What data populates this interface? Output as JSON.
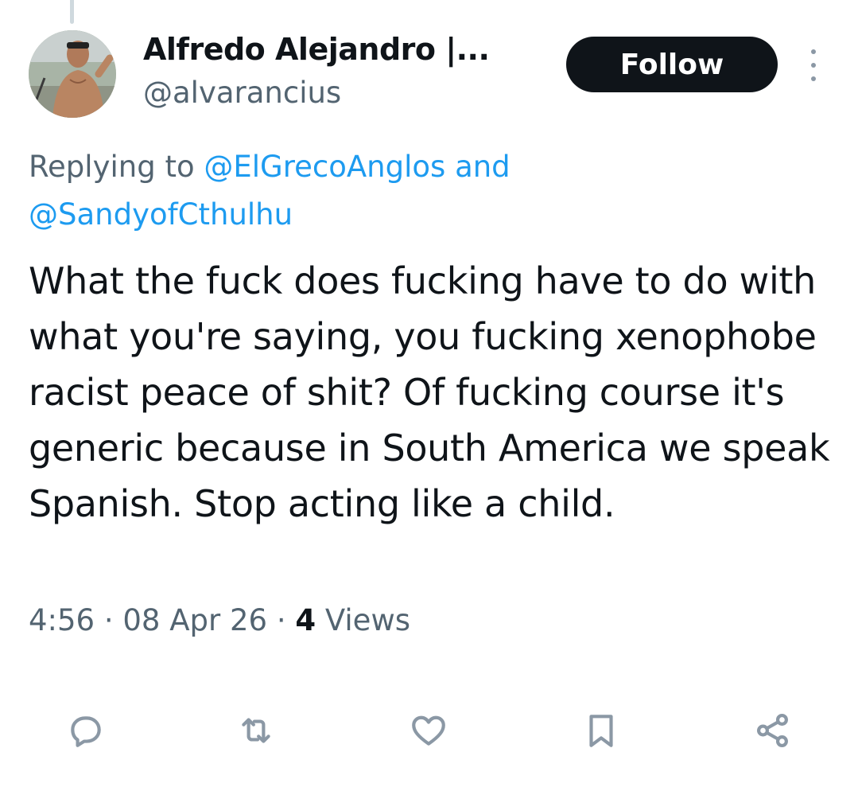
{
  "author": {
    "display_name": "Alfredo Alejandro |...",
    "handle": "@alvarancius",
    "avatar": "avatar-photo"
  },
  "follow_button": {
    "label": "Follow",
    "color": "#0f1419"
  },
  "more_icon": "more-vertical-icon",
  "reply_context": {
    "prefix": "Replying to",
    "mention_1": "@ElGrecoAnglos",
    "joiner": "and",
    "mention_2": "@SandyofCthulhu"
  },
  "tweet": {
    "text": "What the fuck does fucking have to do with what you're saying, you fucking xenophobe racist peace of shit? Of fucking course it's generic because in South America we speak Spanish. Stop acting like a child.",
    "time": "4:56",
    "separator": "·",
    "date": "08 Apr 26",
    "views_count": "4",
    "views_label": "Views"
  },
  "actions": [
    {
      "name": "reply",
      "icon": "reply-icon"
    },
    {
      "name": "retweet",
      "icon": "retweet-icon"
    },
    {
      "name": "like",
      "icon": "heart-icon"
    },
    {
      "name": "bookmark",
      "icon": "bookmark-icon"
    },
    {
      "name": "share",
      "icon": "share-icon"
    }
  ],
  "colors": {
    "link": "#1d9bf0",
    "secondary_text": "#536471",
    "primary_text": "#0f1419",
    "icon": "#8b98a5"
  }
}
